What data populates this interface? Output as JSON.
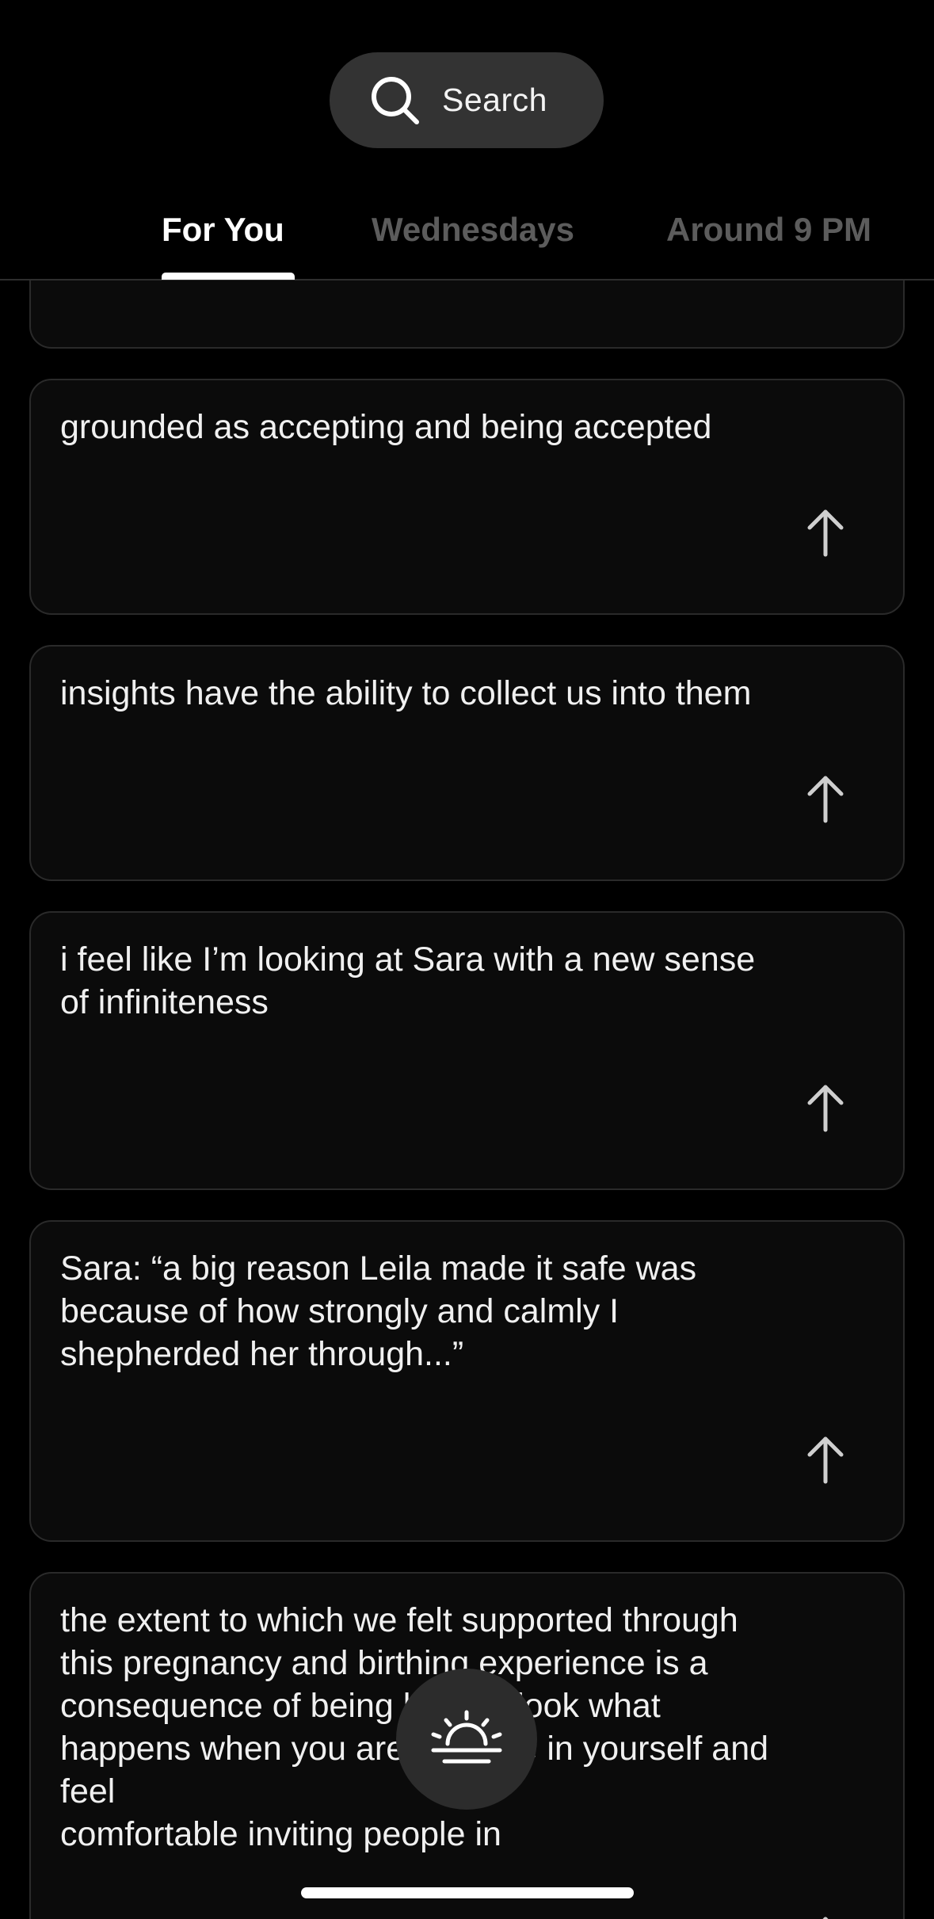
{
  "search": {
    "label": "Search",
    "icon": "search-icon"
  },
  "tabs": [
    {
      "label": "For You",
      "active": true
    },
    {
      "label": "Wednesdays",
      "active": false
    },
    {
      "label": "Around 9 PM",
      "active": false
    }
  ],
  "cards": [
    {
      "text": ""
    },
    {
      "text": "grounded as accepting and being accepted"
    },
    {
      "text": "insights have the ability to collect us into them"
    },
    {
      "text": "i feel like I’m looking at Sara with a new sense\nof infiniteness"
    },
    {
      "text": "Sara: “a big reason Leila made it safe was\nbecause of how strongly and calmly I\nshepherded her through...”"
    },
    {
      "text": "the extent to which we felt supported through\nthis pregnancy and birthing experience is a\nconsequence of being home...look what\nhappens when you are at home in yourself and\nfeel\ncomfortable inviting people in"
    }
  ],
  "fab": {
    "icon": "sunrise-icon"
  },
  "colors": {
    "background": "#000000",
    "card": "#0b0b0b",
    "card_border": "#2a2a2a",
    "search_pill": "#333333",
    "tab_inactive": "#5c5c5c",
    "fab": "#2c2c2c"
  }
}
